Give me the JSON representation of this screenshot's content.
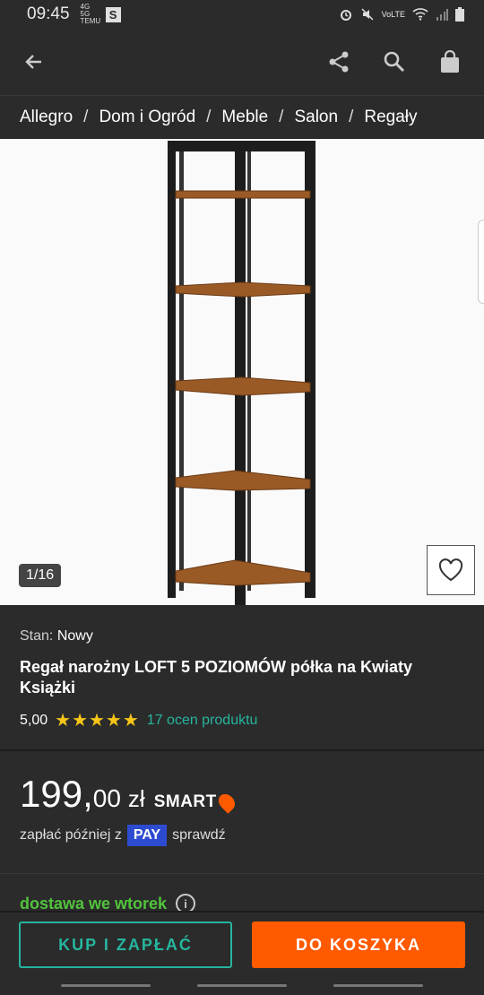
{
  "status": {
    "time": "09:45",
    "mini_text": "4G 5G\nTEMU",
    "badge": "S",
    "right_text": "VoLTE"
  },
  "appbar": {
    "back_icon": "back-arrow-icon",
    "share_icon": "share-icon",
    "search_icon": "search-icon",
    "bag_icon": "shopping-bag-icon"
  },
  "breadcrumb": [
    "Allegro",
    "Dom i Ogród",
    "Meble",
    "Salon",
    "Regały"
  ],
  "gallery": {
    "counter": "1/16"
  },
  "product": {
    "stan_label": "Stan:",
    "stan_value": "Nowy",
    "title": "Regał narożny LOFT 5 POZIOMÓW półka na Kwiaty Książki",
    "rating_value": "5,00",
    "stars": "★★★★★",
    "rating_count": "17 ocen produktu"
  },
  "price": {
    "integer": "199,",
    "decimal": "00",
    "currency": "zł",
    "smart": "SMART"
  },
  "paylater": {
    "prefix": "zapłać później z",
    "pay_badge": "PAY",
    "link": "sprawdź"
  },
  "delivery": {
    "text": "dostawa we wtorek",
    "info": "i"
  },
  "actions": {
    "buy": "KUP I ZAPŁAĆ",
    "cart": "DO KOSZYKA"
  },
  "colors": {
    "accent_teal": "#26b59e",
    "accent_orange": "#ff5a00",
    "delivery_green": "#51c43c",
    "star": "#f5c518",
    "pay_blue": "#2d4bd0"
  }
}
